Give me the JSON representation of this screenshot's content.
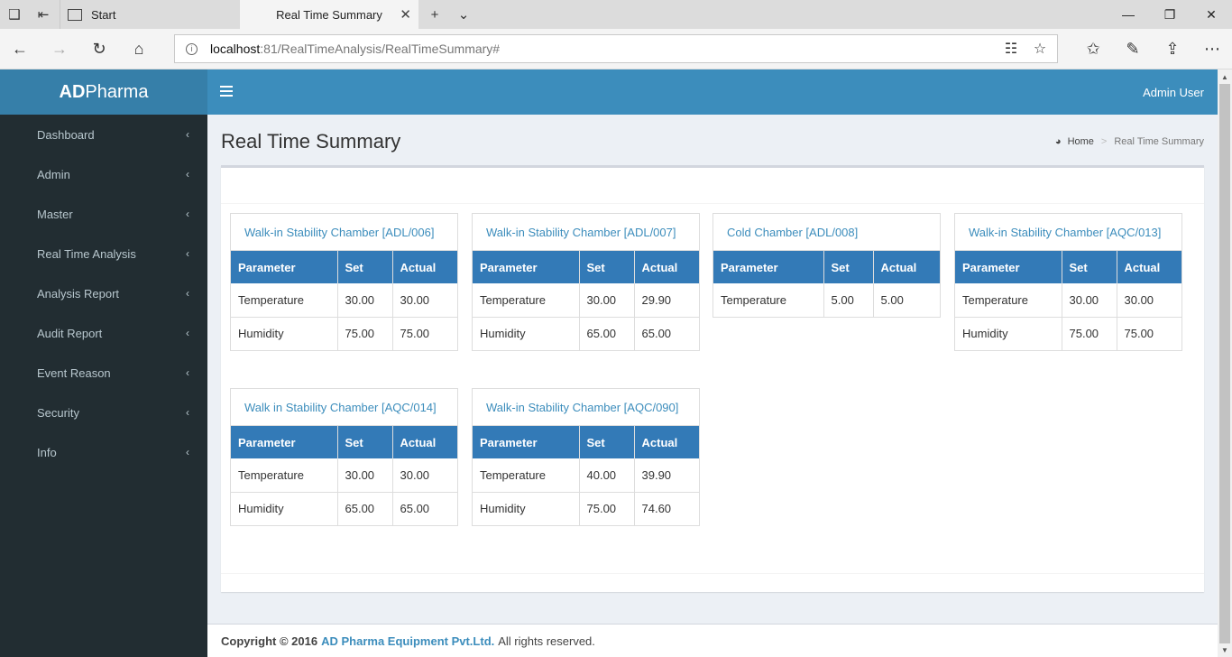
{
  "browser": {
    "tabs": [
      {
        "label": "Start",
        "active": false
      },
      {
        "label": "Real Time Summary",
        "active": true
      }
    ],
    "url_host": "localhost",
    "url_rest": ":81/RealTimeAnalysis/RealTimeSummary#"
  },
  "app": {
    "logo_bold": "AD",
    "logo_rest": "Pharma",
    "user": "Admin User"
  },
  "sidebar": {
    "items": [
      {
        "label": "Dashboard"
      },
      {
        "label": "Admin"
      },
      {
        "label": "Master"
      },
      {
        "label": "Real Time Analysis"
      },
      {
        "label": "Analysis Report"
      },
      {
        "label": "Audit Report"
      },
      {
        "label": "Event Reason"
      },
      {
        "label": "Security"
      },
      {
        "label": "Info"
      }
    ]
  },
  "page": {
    "title": "Real Time Summary",
    "breadcrumb_home": "Home",
    "breadcrumb_current": "Real Time Summary"
  },
  "table_headers": [
    "Parameter",
    "Set",
    "Actual"
  ],
  "chambers": [
    {
      "title": "Walk-in Stability Chamber [ADL/006]",
      "rows": [
        [
          "Temperature",
          "30.00",
          "30.00"
        ],
        [
          "Humidity",
          "75.00",
          "75.00"
        ]
      ]
    },
    {
      "title": "Walk-in Stability Chamber [ADL/007]",
      "rows": [
        [
          "Temperature",
          "30.00",
          "29.90"
        ],
        [
          "Humidity",
          "65.00",
          "65.00"
        ]
      ]
    },
    {
      "title": "Cold Chamber [ADL/008]",
      "rows": [
        [
          "Temperature",
          "5.00",
          "5.00"
        ]
      ]
    },
    {
      "title": "Walk-in Stability Chamber [AQC/013]",
      "rows": [
        [
          "Temperature",
          "30.00",
          "30.00"
        ],
        [
          "Humidity",
          "75.00",
          "75.00"
        ]
      ]
    },
    {
      "title": "Walk in Stability Chamber [AQC/014]",
      "rows": [
        [
          "Temperature",
          "30.00",
          "30.00"
        ],
        [
          "Humidity",
          "65.00",
          "65.00"
        ]
      ]
    },
    {
      "title": "Walk-in Stability Chamber [AQC/090]",
      "rows": [
        [
          "Temperature",
          "40.00",
          "39.90"
        ],
        [
          "Humidity",
          "75.00",
          "74.60"
        ]
      ]
    }
  ],
  "footer": {
    "copyright": "Copyright © 2016",
    "company": "AD Pharma Equipment Pvt.Ltd.",
    "rights": "All rights reserved."
  }
}
